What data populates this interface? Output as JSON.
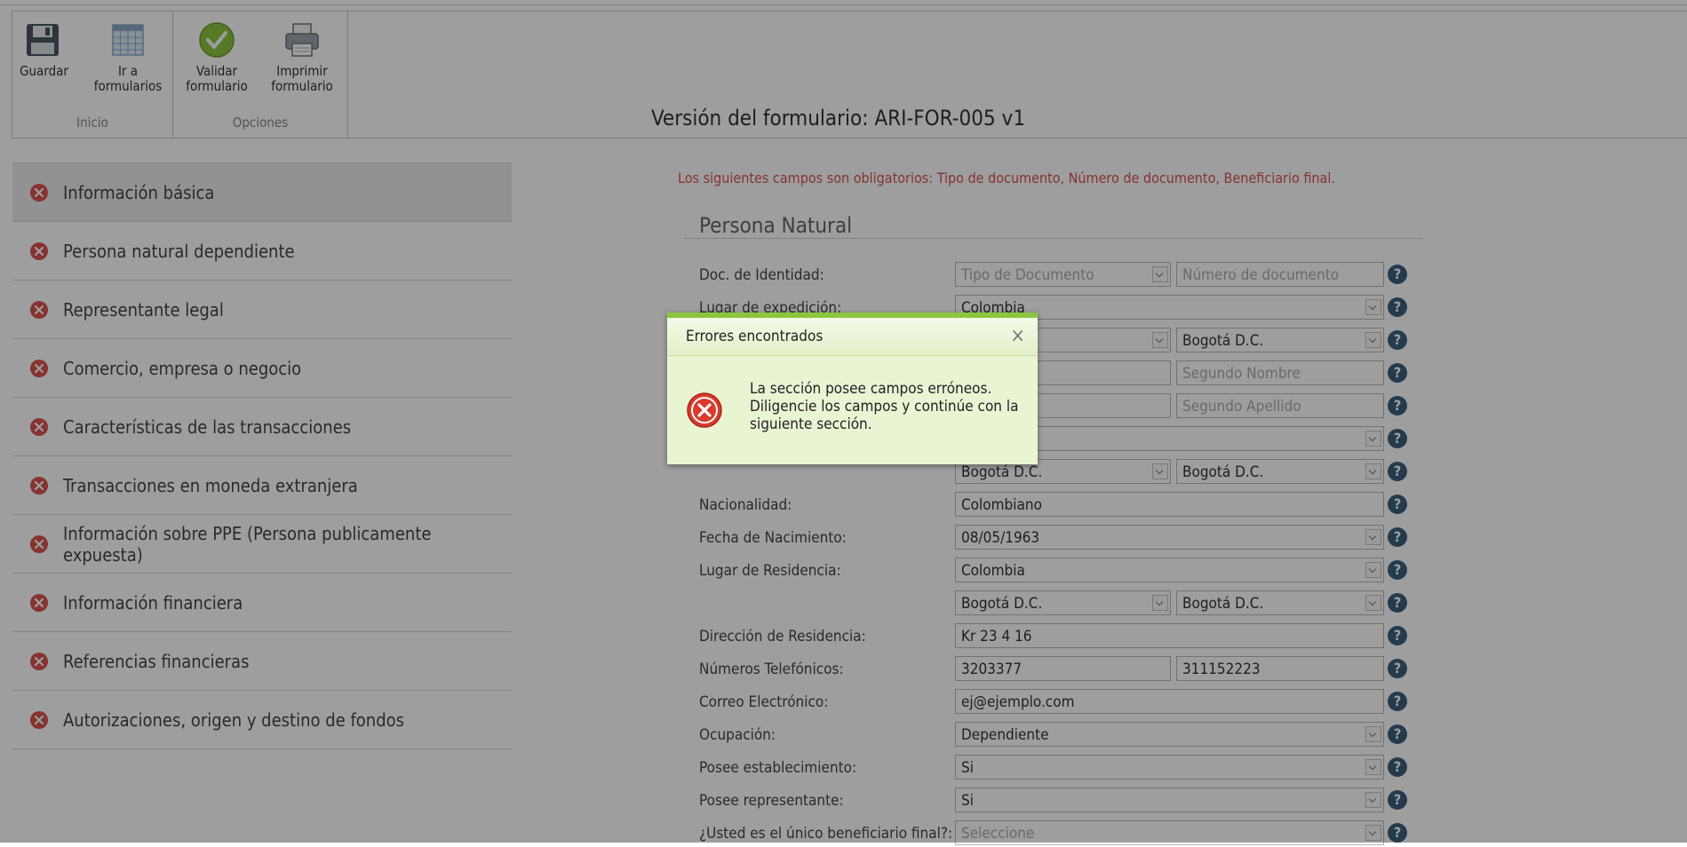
{
  "ribbon": {
    "groups": [
      {
        "label": "Inicio",
        "buttons": [
          {
            "line1": "Guardar",
            "line2": "",
            "icon": "save-icon"
          },
          {
            "line1": "Ir a",
            "line2": "formularios",
            "icon": "grid-icon"
          }
        ]
      },
      {
        "label": "Opciones",
        "buttons": [
          {
            "line1": "Validar",
            "line2": "formulario",
            "icon": "check-icon"
          },
          {
            "line1": "Imprimir",
            "line2": "formulario",
            "icon": "printer-icon"
          }
        ]
      }
    ]
  },
  "version_title": "Versión del formulario: ARI-FOR-005 v1",
  "sidebar": {
    "items": [
      {
        "label": "Información básica"
      },
      {
        "label": "Persona natural dependiente"
      },
      {
        "label": "Representante legal"
      },
      {
        "label": "Comercio, empresa o negocio"
      },
      {
        "label": "Características de las transacciones"
      },
      {
        "label": "Transacciones en moneda extranjera"
      },
      {
        "label": "Información sobre PPE (Persona publicamente expuesta)"
      },
      {
        "label": "Información financiera"
      },
      {
        "label": "Referencias financieras"
      },
      {
        "label": "Autorizaciones, origen y destino de fondos"
      }
    ]
  },
  "form": {
    "required_message": "Los siguientes campos son obligatorios: Tipo de documento, Número de documento, Beneficiario final.",
    "section_title": "Persona Natural",
    "help_glyph": "?",
    "fields": {
      "doc_label": "Doc. de Identidad:",
      "doc_type_placeholder": "Tipo de Documento",
      "doc_number_placeholder": "Número de documento",
      "exp_label": "Lugar de expedición:",
      "exp_country": "Colombia",
      "exp_city": "Bogotá D.C.",
      "second_name_placeholder": "Segundo Nombre",
      "second_surname_placeholder": "Segundo Apellido",
      "birth_dept": "Bogotá D.C.",
      "birth_city": "Bogotá D.C.",
      "nationality_label": "Nacionalidad:",
      "nationality": "Colombiano",
      "birthdate_label": "Fecha de Nacimiento:",
      "birthdate": "08/05/1963",
      "residence_label": "Lugar de Residencia:",
      "residence_country": "Colombia",
      "residence_dept": "Bogotá D.C.",
      "residence_city": "Bogotá D.C.",
      "address_label": "Dirección de Residencia:",
      "address": "Kr 23 4 16",
      "phones_label": "Números Telefónicos:",
      "phone1": "3203377",
      "phone2": "311152223",
      "email_label": "Correo Electrónico:",
      "email": "ej@ejemplo.com",
      "occupation_label": "Ocupación:",
      "occupation": "Dependiente",
      "has_establishment_label": "Posee establecimiento:",
      "has_establishment": "Si",
      "has_representative_label": "Posee representante:",
      "has_representative": "Si",
      "beneficiary_label": "¿Usted es el único beneficiario final?:",
      "beneficiary_placeholder": "Seleccione"
    }
  },
  "modal": {
    "title": "Errores encontrados",
    "close": "×",
    "message": "La sección posee campos erróneos. Diligencie los campos y continúe con la siguiente sección."
  },
  "colors": {
    "error_red": "#d9534f",
    "help_blue": "#3a5f7f",
    "modal_green": "#8cc63e"
  }
}
